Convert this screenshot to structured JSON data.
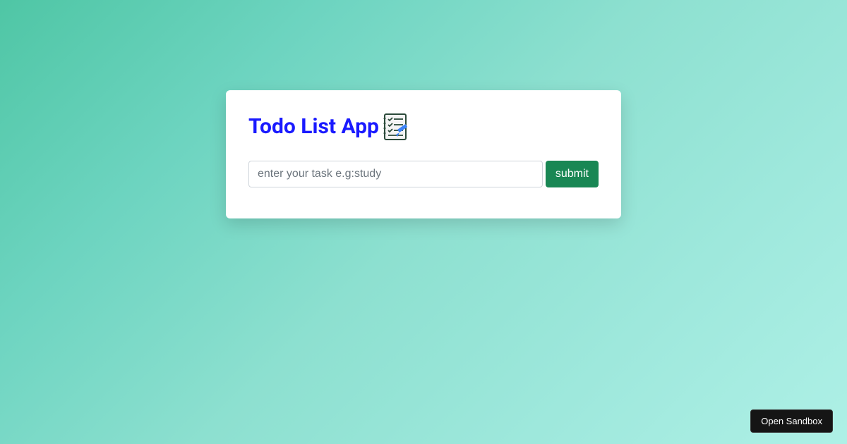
{
  "card": {
    "title": "Todo List App",
    "input_placeholder": "enter your task e.g:study",
    "submit_label": "submit"
  },
  "footer": {
    "sandbox_label": "Open Sandbox"
  },
  "colors": {
    "title": "#1a1aff",
    "submit_bg": "#198754",
    "card_bg": "#ffffff"
  }
}
